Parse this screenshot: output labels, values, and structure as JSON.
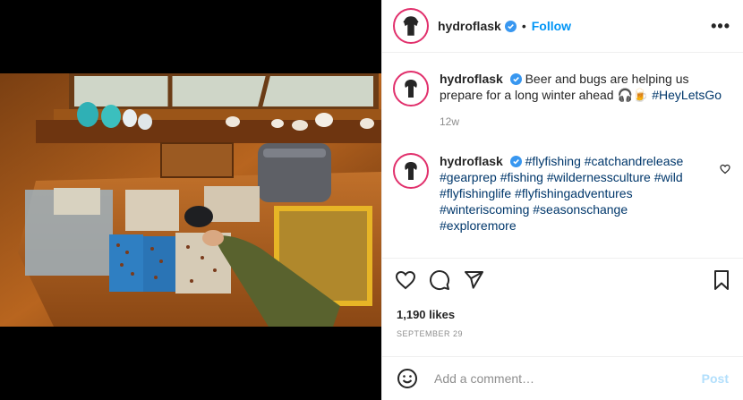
{
  "post": {
    "username": "hydroflask",
    "follow_label": "Follow",
    "more_label": "•••",
    "photo_alt": "Fly fishing flies in boxes on a wooden workbench"
  },
  "caption": {
    "username": "hydroflask",
    "text": "Beer and bugs are helping us prepare for a long winter ahead 🎧🍺",
    "hashtag": "#HeyLetsGo",
    "time": "12w"
  },
  "comment": {
    "username": "hydroflask",
    "hashtags": "#flyfishing #catchandrelease #gearprep #fishing #wildernessculture #wild #flyfishinglife #flyfishingadventures #winteriscoming #seasonschange #exploremore"
  },
  "stats": {
    "likes": "1,190 likes",
    "date": "SEPTEMBER 29"
  },
  "composer": {
    "placeholder": "Add a comment…",
    "post_label": "Post"
  },
  "icons": {
    "like": "heart-icon",
    "comment": "comment-icon",
    "share": "send-icon",
    "save": "bookmark-icon",
    "emoji": "emoji-icon",
    "verified": "verified-badge-icon"
  },
  "colors": {
    "accent": "#0095f6",
    "hashtag": "#00376b",
    "muted": "#8e8e8e",
    "post_disabled": "#b2dffc"
  }
}
